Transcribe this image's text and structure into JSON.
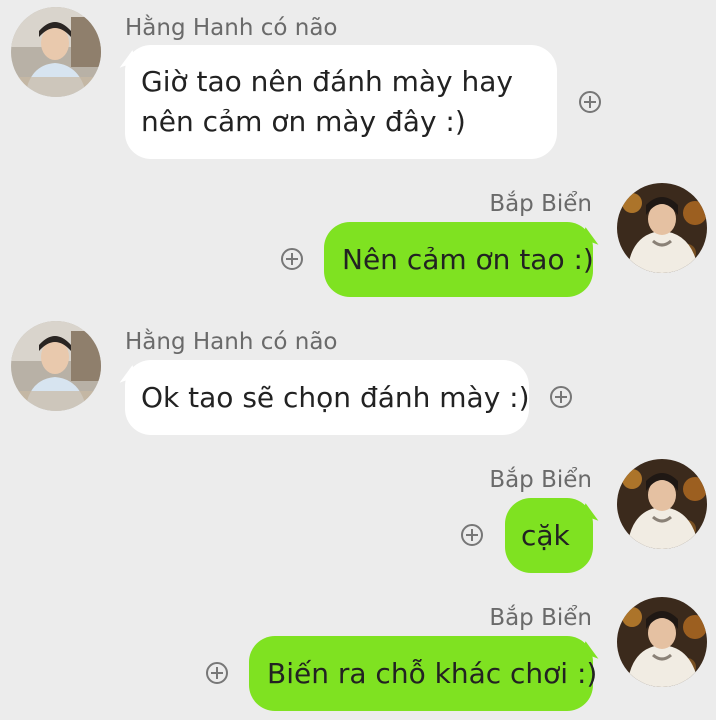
{
  "colors": {
    "background": "#ececec",
    "incoming_bubble": "#ffffff",
    "outgoing_bubble": "#7fe221",
    "name_text": "#6a6a6a"
  },
  "messages": [
    {
      "sender": "Hằng Hanh có não",
      "direction": "incoming",
      "lines": [
        "Giờ tao nên đánh mày hay",
        "nên cảm ơn mày đây :)"
      ],
      "action_icon": "add-circle-icon"
    },
    {
      "sender": "Bắp Biển",
      "direction": "outgoing",
      "lines": [
        "Nên cảm ơn tao :)"
      ],
      "action_icon": "add-circle-icon"
    },
    {
      "sender": "Hằng Hanh có não",
      "direction": "incoming",
      "lines": [
        "Ok tao sẽ chọn đánh mày :)"
      ],
      "action_icon": "add-circle-icon"
    },
    {
      "sender": "Bắp Biển",
      "direction": "outgoing",
      "lines": [
        "cặk"
      ],
      "action_icon": "add-circle-icon"
    },
    {
      "sender": "Bắp Biển",
      "direction": "outgoing",
      "lines": [
        "Biến ra chỗ khác chơi :)"
      ],
      "action_icon": "add-circle-icon"
    }
  ]
}
